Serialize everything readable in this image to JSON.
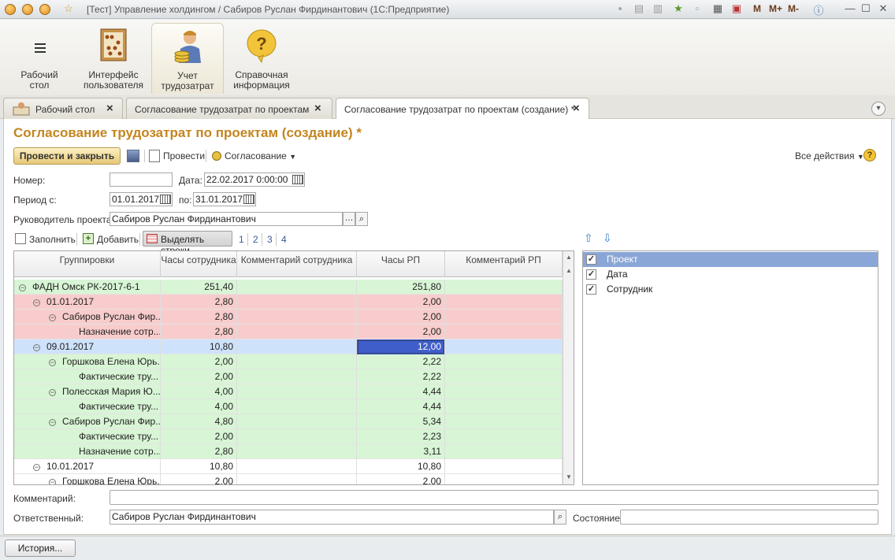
{
  "window": {
    "title": "[Тест] Управление холдингом / Сабиров Руслан Фирдинантович  (1С:Предприятие)",
    "memory_buttons": [
      "M",
      "M+",
      "M-"
    ]
  },
  "sections": [
    {
      "label": "Рабочий\nстол",
      "icon": "menu-icon"
    },
    {
      "label": "Интерфейс\nпользователя",
      "icon": "abacus-icon"
    },
    {
      "label": "Учет\nтрудозатрат",
      "icon": "worker-icon"
    },
    {
      "label": "Справочная\nинформация",
      "icon": "question-icon"
    }
  ],
  "tabs": [
    {
      "label": "Рабочий стол"
    },
    {
      "label": "Согласование трудозатрат по проектам"
    },
    {
      "label": "Согласование трудозатрат по проектам (создание) *"
    }
  ],
  "form": {
    "title": "Согласование трудозатрат по проектам (создание) *",
    "toolbar": {
      "post_close": "Провести и закрыть",
      "post": "Провести",
      "approval": "Согласование",
      "all_actions": "Все действия"
    },
    "fields": {
      "number_label": "Номер:",
      "number_value": "",
      "date_label": "Дата:",
      "date_value": "22.02.2017  0:00:00",
      "period_label": "Период с:",
      "period_from": "01.01.2017",
      "period_to_label": "по:",
      "period_to": "31.01.2017",
      "manager_label": "Руководитель проекта:",
      "manager_value": "Сабиров Руслан Фирдинантович"
    },
    "grid_toolbar": {
      "fill": "Заполнить",
      "add": "Добавить",
      "highlight": "Выделять строки",
      "levels": [
        "1",
        "2",
        "3",
        "4"
      ]
    },
    "columns": [
      "Группировки",
      "Часы сотрудника",
      "Комментарий сотрудника",
      "Часы РП",
      "Комментарий РП"
    ],
    "rows": [
      {
        "indent": 0,
        "toggle": true,
        "name": "ФАДН Омск РК-2017-6-1",
        "hours": "251,40",
        "rp": "251,80",
        "color": "green"
      },
      {
        "indent": 1,
        "toggle": true,
        "name": "01.01.2017",
        "hours": "2,80",
        "rp": "2,00",
        "color": "red"
      },
      {
        "indent": 2,
        "toggle": true,
        "name": "Сабиров Руслан Фир...",
        "hours": "2,80",
        "rp": "2,00",
        "color": "red"
      },
      {
        "indent": 3,
        "toggle": false,
        "name": "Назначение сотр...",
        "hours": "2,80",
        "rp": "2,00",
        "color": "red"
      },
      {
        "indent": 1,
        "toggle": true,
        "name": "09.01.2017",
        "hours": "10,80",
        "rp": "12,00",
        "color": "blue",
        "selected_rp": true
      },
      {
        "indent": 2,
        "toggle": true,
        "name": "Горшкова Елена Юрь...",
        "hours": "2,00",
        "rp": "2,22",
        "color": "green"
      },
      {
        "indent": 3,
        "toggle": false,
        "name": "Фактические тру...",
        "hours": "2,00",
        "rp": "2,22",
        "color": "green"
      },
      {
        "indent": 2,
        "toggle": true,
        "name": "Полесская Мария Ю...",
        "hours": "4,00",
        "rp": "4,44",
        "color": "green"
      },
      {
        "indent": 3,
        "toggle": false,
        "name": "Фактические тру...",
        "hours": "4,00",
        "rp": "4,44",
        "color": "green"
      },
      {
        "indent": 2,
        "toggle": true,
        "name": "Сабиров Руслан Фир...",
        "hours": "4,80",
        "rp": "5,34",
        "color": "green"
      },
      {
        "indent": 3,
        "toggle": false,
        "name": "Фактические тру...",
        "hours": "2,00",
        "rp": "2,23",
        "color": "green"
      },
      {
        "indent": 3,
        "toggle": false,
        "name": "Назначение сотр...",
        "hours": "2,80",
        "rp": "3,11",
        "color": "green"
      },
      {
        "indent": 1,
        "toggle": true,
        "name": "10.01.2017",
        "hours": "10,80",
        "rp": "10,80",
        "color": "white"
      },
      {
        "indent": 2,
        "toggle": true,
        "name": "Горшкова Елена Юрь...",
        "hours": "2,00",
        "rp": "2,00",
        "color": "white"
      }
    ],
    "groupings": [
      {
        "label": "Проект",
        "checked": true,
        "selected": true
      },
      {
        "label": "Дата",
        "checked": true,
        "selected": false
      },
      {
        "label": "Сотрудник",
        "checked": true,
        "selected": false
      }
    ],
    "bottom": {
      "comment_label": "Комментарий:",
      "comment_value": "",
      "responsible_label": "Ответственный:",
      "responsible_value": "Сабиров Руслан Фирдинантович",
      "state_label": "Состояние:",
      "state_value": ""
    }
  },
  "statusbar": {
    "history": "История..."
  },
  "colors": {
    "green": "#d8f5d5",
    "red": "#f8cccc",
    "blue": "#cfe2fb",
    "white": "#ffffff",
    "selected_cell": "#3f5ec9",
    "accent_title": "#c3851f"
  }
}
